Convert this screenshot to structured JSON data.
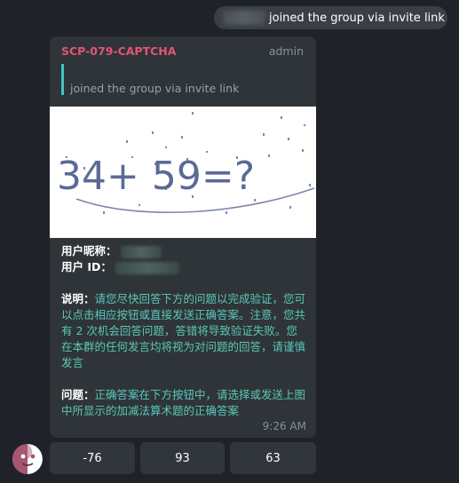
{
  "system_message": {
    "text": "joined the group via invite link"
  },
  "message": {
    "sender": "SCP-079-CAPTCHA",
    "role": "admin",
    "reply_text": "joined the group via invite link",
    "captcha_text": "34+ 59=?",
    "nickname_label": "用户昵称：",
    "userid_label": "用户 ID：",
    "instruction_label": "说明：",
    "instruction_text_1": "请您尽快回答下方的问题以完成验证，您可以点击相应按钮或直接发送正确答案。注意，您共有 ",
    "instruction_count": "2",
    "instruction_text_2": " 次机会回答问题，答错将导致验证失败。您在本群的任何发言均将视为对问题的回答，请谨慎发言",
    "question_label": "问题：",
    "question_text": "正确答案在下方按钮中，请选择或发送上图中所显示的加减法算术题的正确答案",
    "time": "9:26 AM"
  },
  "keyboard": {
    "buttons": [
      "-76",
      "93",
      "63"
    ]
  },
  "colors": {
    "sender": "#e25575",
    "accent": "#3fc8c0",
    "bubble": "#2f3439",
    "background": "#1f2329"
  },
  "icons": {
    "avatar": "bot-avatar-icon"
  }
}
